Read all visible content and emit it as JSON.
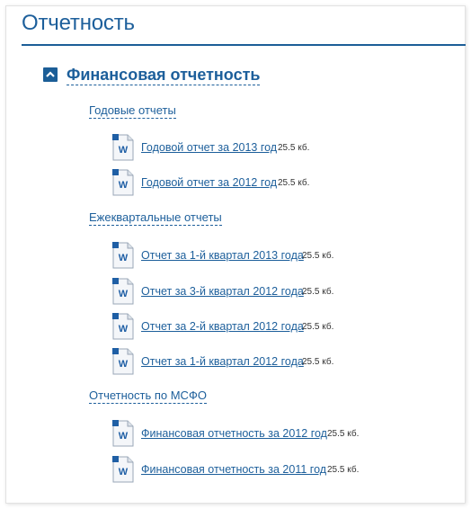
{
  "page": {
    "title": "Отчетность"
  },
  "section": {
    "title": "Финансовая отчетность",
    "toggle_icon": "chevron-up-icon",
    "accent": "#1c5e97"
  },
  "groups": [
    {
      "label": "Годовые отчеты",
      "files": [
        {
          "name": "Годовой отчет за 2013 год",
          "size": "25.5 кб.",
          "icon": "word-document-icon"
        },
        {
          "name": "Годовой отчет за 2012 год",
          "size": "25.5 кб.",
          "icon": "word-document-icon"
        }
      ]
    },
    {
      "label": "Ежеквартальные отчеты",
      "files": [
        {
          "name": "Отчет за 1-й квартал 2013 года",
          "size": "25.5 кб.",
          "icon": "word-document-icon"
        },
        {
          "name": "Отчет за 3-й квартал 2012 года",
          "size": "25.5 кб.",
          "icon": "word-document-icon"
        },
        {
          "name": "Отчет за 2-й квартал 2012 года",
          "size": "25.5 кб.",
          "icon": "word-document-icon"
        },
        {
          "name": "Отчет за 1-й квартал 2012 года",
          "size": "25.5 кб.",
          "icon": "word-document-icon"
        }
      ]
    },
    {
      "label": "Отчетность по МСФО",
      "files": [
        {
          "name": "Финансовая отчетность за 2012 год",
          "size": "25.5 кб.",
          "icon": "word-document-icon"
        },
        {
          "name": "Финансовая отчетность за 2011 год",
          "size": "25.5 кб.",
          "icon": "word-document-icon"
        }
      ]
    }
  ]
}
